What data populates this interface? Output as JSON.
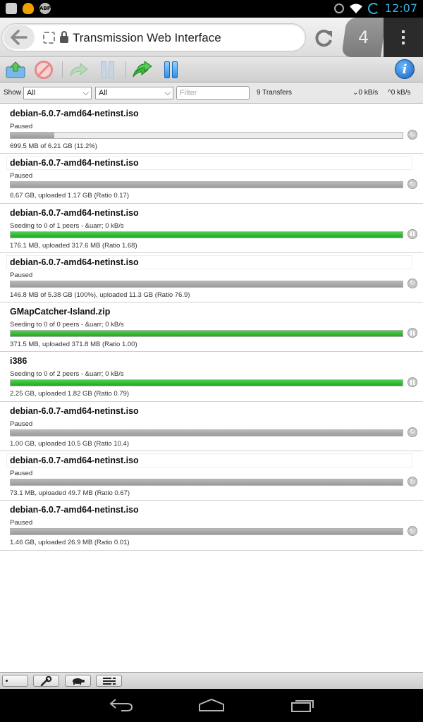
{
  "status_bar": {
    "clock": "12:07",
    "left_icons": [
      "image-icon",
      "bulb-icon",
      "abp-icon"
    ],
    "abp_label": "ABP",
    "right_icons": [
      "alarm-icon",
      "wifi-icon",
      "battery-icon"
    ]
  },
  "browser": {
    "tab_title": "Transmission Web Interface",
    "tab_count": "4"
  },
  "toolbar": {
    "buttons": [
      "open-torrent",
      "remove-torrent",
      "resume-selected",
      "pause-selected",
      "resume-all",
      "pause-all",
      "inspector"
    ]
  },
  "filter_bar": {
    "show_label": "Show",
    "state_filter": "All",
    "tracker_filter": "All",
    "filter_placeholder": "Filter",
    "transfer_count": "9 Transfers",
    "download_speed": "0 kB/s",
    "upload_speed": "0 kB/s"
  },
  "torrents": [
    {
      "name": "debian-6.0.7-amd64-netinst.iso",
      "status": "Paused",
      "info": "699.5 MB of 6.21 GB (11.2%)",
      "progress": 0.112,
      "state": "paused"
    },
    {
      "name": "debian-6.0.7-amd64-netinst.iso",
      "status": "Paused",
      "info": "6.67 GB, uploaded 1.17 GB (Ratio 0.17)",
      "progress": 1.0,
      "state": "paused"
    },
    {
      "name": "debian-6.0.7-amd64-netinst.iso",
      "status": "Seeding to 0 of 1 peers - &uarr; 0 kB/s",
      "info": "176.1 MB, uploaded 317.6 MB (Ratio 1.68)",
      "progress": 1.0,
      "state": "seeding"
    },
    {
      "name": "debian-6.0.7-amd64-netinst.iso",
      "status": "Paused",
      "info": "146.8 MB of 5.38 GB (100%), uploaded 11.3 GB (Ratio 76.9)",
      "progress": 1.0,
      "state": "paused"
    },
    {
      "name": "GMapCatcher-Island.zip",
      "status": "Seeding to 0 of 0 peers - &uarr; 0 kB/s",
      "info": "371.5 MB, uploaded 371.8 MB (Ratio 1.00)",
      "progress": 1.0,
      "state": "seeding"
    },
    {
      "name": "i386",
      "status": "Seeding to 0 of 2 peers - &uarr; 0 kB/s",
      "info": "2.25 GB, uploaded 1.82 GB (Ratio 0.79)",
      "progress": 1.0,
      "state": "seeding"
    },
    {
      "name": "debian-6.0.7-amd64-netinst.iso",
      "status": "Paused",
      "info": "1.00 GB, uploaded 10.5 GB (Ratio 10.4)",
      "progress": 1.0,
      "state": "paused"
    },
    {
      "name": "debian-6.0.7-amd64-netinst.iso",
      "status": "Paused",
      "info": "73.1 MB, uploaded 49.7 MB (Ratio 0.67)",
      "progress": 1.0,
      "state": "paused"
    },
    {
      "name": "debian-6.0.7-amd64-netinst.iso",
      "status": "Paused",
      "info": "1.46 GB, uploaded 26.9 MB (Ratio 0.01)",
      "progress": 1.0,
      "state": "paused"
    }
  ],
  "bottom_bar": {
    "buttons": [
      "compact-toggle",
      "settings-wrench",
      "turtle-speed",
      "sort-menu"
    ]
  },
  "colors": {
    "seeding": "#22aa22",
    "paused": "#a0a0a0",
    "accent": "#33b5e5"
  }
}
